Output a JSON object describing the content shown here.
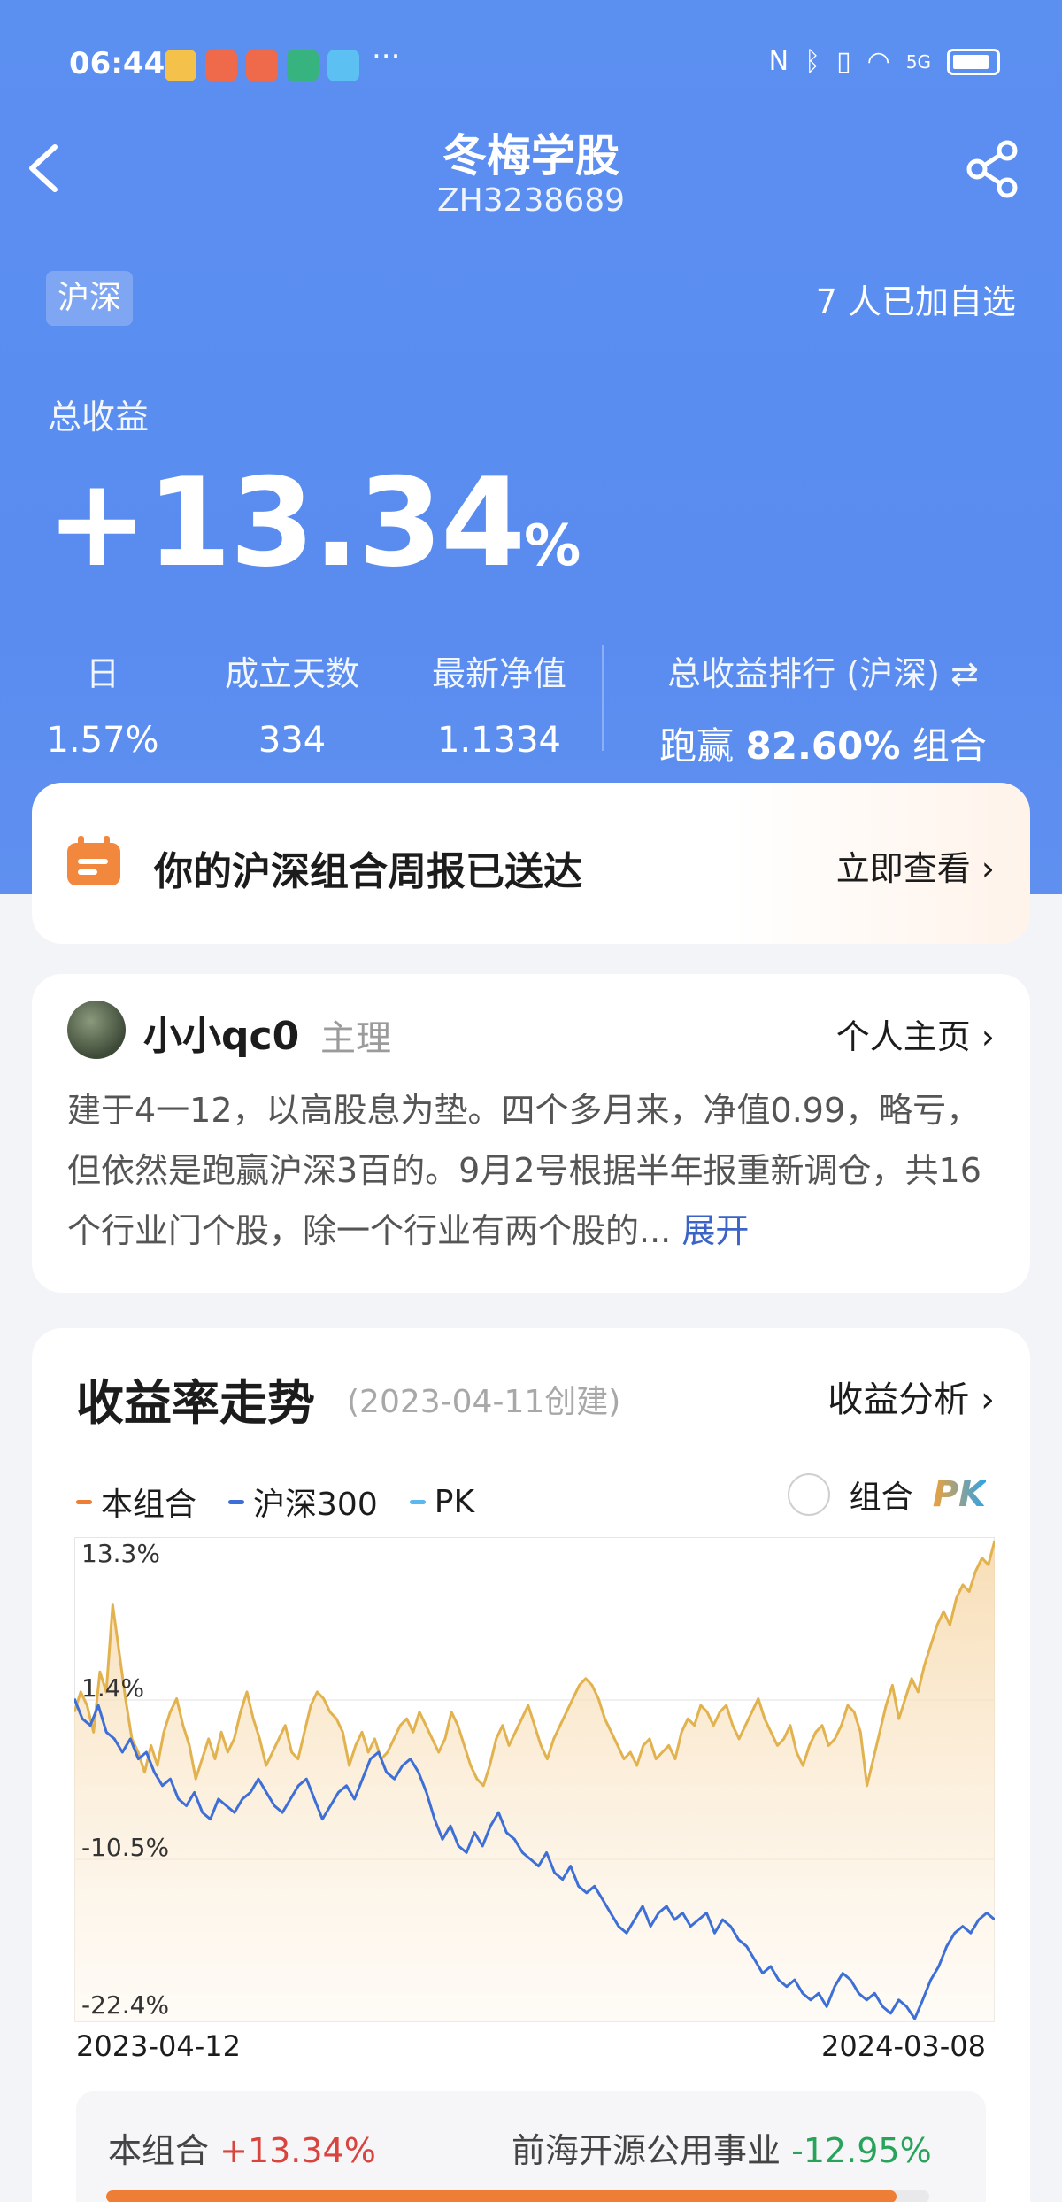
{
  "status": {
    "time": "06:44",
    "dots": "···",
    "signal": "5G"
  },
  "nav": {
    "title": "冬梅学股",
    "subtitle": "ZH3238689"
  },
  "header": {
    "market_tag": "沪深",
    "followers": "7 人已加自选"
  },
  "total": {
    "label": "总收益",
    "value": "+13.34",
    "unit": "%"
  },
  "stats": [
    {
      "label": "日",
      "value": "1.57%"
    },
    {
      "label": "成立天数",
      "value": "334"
    },
    {
      "label": "最新净值",
      "value": "1.1334"
    }
  ],
  "rank": {
    "label": "总收益排行 (沪深) ⇄",
    "prefix": "跑赢 ",
    "value": "82.60%",
    "suffix": " 组合"
  },
  "report": {
    "title": "你的沪深组合周报已送达",
    "link": "立即查看"
  },
  "author": {
    "name": "小小qc0",
    "role": "主理",
    "home_link": "个人主页",
    "description": "建于4一12，以高股息为垫。四个多月来，净值0.99，略亏，但依然是跑赢沪深3百的。9月2号根据半年报重新调仓，共16个行业门个股，除一个行业有两个股的...",
    "expand": "展开"
  },
  "chart_section": {
    "title": "收益率走势",
    "created": "(2023-04-11创建)",
    "analysis_link": "收益分析",
    "legend": [
      {
        "label": "本组合",
        "color": "#ee7d35"
      },
      {
        "label": "沪深300",
        "color": "#3d6fd6"
      },
      {
        "label": "PK",
        "color": "#5bb7ee"
      }
    ],
    "pk_label": "组合",
    "pk_badge": "PK"
  },
  "chart_data": {
    "type": "line",
    "x": [
      "2023-04-12",
      "2024-03-08"
    ],
    "x_start_label": "2023-04-12",
    "x_end_label": "2024-03-08",
    "y_tick_labels": [
      "13.3%",
      "1.4%",
      "-10.5%",
      "-22.4%"
    ],
    "ylim": [
      -22.4,
      13.3
    ],
    "series": [
      {
        "name": "本组合",
        "color": "#e2b24f",
        "values": [
          0.5,
          2.0,
          1.0,
          -1.0,
          3.5,
          2.0,
          8.5,
          5.0,
          1.5,
          -1.5,
          -2.5,
          -4.0,
          -2.0,
          -3.5,
          -1.0,
          0.5,
          1.5,
          -0.5,
          -2.0,
          -4.5,
          -3.0,
          -1.5,
          -3.0,
          -1.0,
          -2.5,
          -1.5,
          0.5,
          2.0,
          0.0,
          -1.5,
          -3.5,
          -2.5,
          -1.5,
          -0.5,
          -2.5,
          -3.0,
          -1.0,
          1.0,
          2.0,
          1.5,
          0.5,
          0.0,
          -1.0,
          -3.5,
          -2.0,
          -1.0,
          -2.5,
          -1.5,
          -3.0,
          -2.5,
          -1.5,
          -0.5,
          0.0,
          -1.0,
          0.5,
          -0.5,
          -1.5,
          -2.5,
          -1.5,
          0.5,
          -0.5,
          -2.0,
          -3.5,
          -4.5,
          -5.0,
          -3.5,
          -1.5,
          -0.5,
          -2.0,
          -1.0,
          0.0,
          1.0,
          -0.5,
          -2.0,
          -3.0,
          -1.5,
          -0.5,
          0.5,
          1.5,
          2.5,
          3.0,
          2.5,
          1.5,
          0.0,
          -1.0,
          -2.0,
          -3.0,
          -2.5,
          -3.5,
          -2.0,
          -1.5,
          -3.0,
          -2.5,
          -2.0,
          -3.0,
          -1.0,
          0.0,
          -0.5,
          1.0,
          0.5,
          -0.5,
          0.5,
          1.0,
          -0.5,
          -1.5,
          -0.5,
          0.5,
          1.5,
          0.0,
          -1.0,
          -2.0,
          -1.5,
          -0.5,
          -2.5,
          -3.5,
          -2.0,
          -1.0,
          -0.5,
          -2.0,
          -1.5,
          -0.5,
          1.0,
          0.5,
          -1.0,
          -5.0,
          -3.0,
          -1.0,
          1.0,
          2.5,
          0.0,
          1.5,
          3.0,
          2.0,
          4.0,
          5.5,
          7.0,
          8.0,
          7.0,
          9.0,
          10.0,
          9.5,
          11.0,
          12.0,
          11.5,
          13.3
        ]
      },
      {
        "name": "沪深300",
        "color": "#3d6fd6",
        "values": [
          1.5,
          0.0,
          -0.5,
          1.0,
          -1.0,
          -1.5,
          -2.5,
          -1.5,
          -3.0,
          -2.5,
          -4.0,
          -5.0,
          -4.5,
          -6.0,
          -6.5,
          -5.5,
          -7.0,
          -7.5,
          -6.0,
          -6.5,
          -7.0,
          -6.0,
          -5.5,
          -4.5,
          -5.5,
          -6.5,
          -7.0,
          -6.0,
          -5.0,
          -4.5,
          -6.0,
          -7.5,
          -6.5,
          -5.5,
          -5.0,
          -6.0,
          -4.5,
          -3.0,
          -2.5,
          -4.0,
          -4.5,
          -3.5,
          -3.0,
          -4.0,
          -5.5,
          -7.5,
          -9.0,
          -8.0,
          -9.5,
          -10.0,
          -8.5,
          -9.5,
          -8.0,
          -7.0,
          -8.5,
          -9.0,
          -10.0,
          -10.5,
          -11.0,
          -10.0,
          -11.5,
          -12.0,
          -11.0,
          -12.5,
          -13.0,
          -12.5,
          -13.5,
          -14.5,
          -15.5,
          -16.0,
          -15.0,
          -14.0,
          -15.5,
          -14.5,
          -14.0,
          -15.0,
          -14.5,
          -15.5,
          -15.0,
          -14.5,
          -16.0,
          -15.0,
          -15.5,
          -16.5,
          -17.0,
          -18.0,
          -19.0,
          -18.5,
          -19.5,
          -20.0,
          -19.5,
          -20.5,
          -21.0,
          -20.5,
          -21.5,
          -20.0,
          -19.0,
          -19.5,
          -20.5,
          -21.0,
          -20.5,
          -21.5,
          -22.0,
          -21.0,
          -21.5,
          -22.4,
          -21.0,
          -19.5,
          -18.5,
          -17.0,
          -16.0,
          -15.5,
          -16.0,
          -15.0,
          -14.5,
          -15.0
        ]
      }
    ]
  },
  "compare": {
    "left_label": "本组合",
    "left_value": "+13.34%",
    "right_label": "前海开源公用事业",
    "right_value": "-12.95%",
    "fill_fraction": 0.96
  }
}
